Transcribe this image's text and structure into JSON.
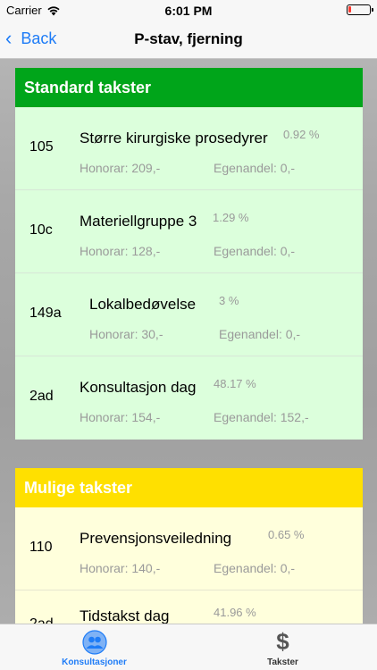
{
  "status": {
    "carrier": "Carrier",
    "time": "6:01 PM"
  },
  "nav": {
    "back_label": "Back",
    "title": "P-stav, fjerning"
  },
  "sections": [
    {
      "title": "Standard takster",
      "rows": [
        {
          "code": "105",
          "name": "Større kirurgiske prosedyrer",
          "pct": "0.92 %",
          "honorar": "Honorar: 209,-",
          "egenandel": "Egenandel: 0,-"
        },
        {
          "code": "10c",
          "name": "Materiellgruppe 3",
          "pct": "1.29 %",
          "honorar": "Honorar: 128,-",
          "egenandel": "Egenandel: 0,-"
        },
        {
          "code": "149a",
          "name": "Lokalbedøvelse",
          "pct": "3 %",
          "honorar": "Honorar: 30,-",
          "egenandel": "Egenandel: 0,-"
        },
        {
          "code": "2ad",
          "name": "Konsultasjon dag",
          "pct": "48.17 %",
          "honorar": "Honorar: 154,-",
          "egenandel": "Egenandel: 152,-"
        }
      ]
    },
    {
      "title": "Mulige takster",
      "rows": [
        {
          "code": "110",
          "name": "Prevensjonsveiledning",
          "pct": "0.65 %",
          "honorar": "Honorar: 140,-",
          "egenandel": "Egenandel: 0,-"
        },
        {
          "code": "2ad",
          "name": "Tidstakst dag",
          "pct": "41.96 %",
          "honorar": "",
          "egenandel": ""
        }
      ]
    }
  ],
  "tabs": [
    {
      "label": "Konsultasjoner",
      "icon": "people-icon",
      "active": true
    },
    {
      "label": "Takster",
      "icon": "dollar-icon",
      "active": false
    }
  ],
  "colors": {
    "accent": "#1e7cf7",
    "standard_header": "#00a51a",
    "mulige_header": "#ffe000",
    "standard_body": "#dcffdc",
    "mulige_body": "#ffffdc"
  }
}
